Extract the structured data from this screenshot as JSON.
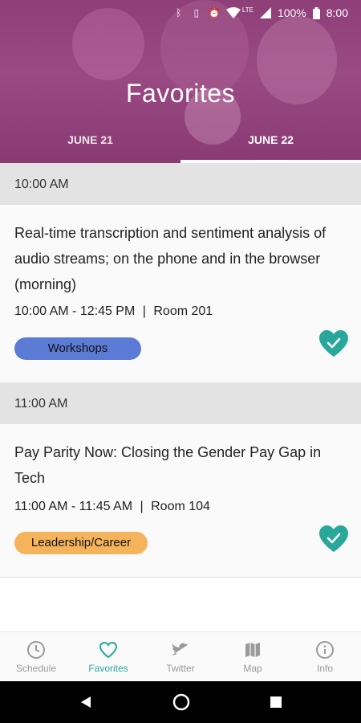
{
  "status_bar": {
    "battery": "100%",
    "time": "8:00",
    "network": "LTE"
  },
  "header": {
    "title": "Favorites",
    "tabs": [
      {
        "label": "JUNE 21",
        "active": false
      },
      {
        "label": "JUNE 22",
        "active": true
      }
    ]
  },
  "sessions": [
    {
      "time_header": "10:00 AM",
      "title": "Real-time transcription and sentiment analysis of audio streams; on the phone and in the browser (morning)",
      "time_range": "10:00 AM - 12:45 PM",
      "separator": "|",
      "room": "Room 201",
      "track": "Workshops",
      "track_color": "#5b7bd5",
      "favorited": true
    },
    {
      "time_header": "11:00 AM",
      "title": "Pay Parity Now: Closing the Gender Pay Gap in Tech",
      "time_range": "11:00 AM - 11:45 AM",
      "separator": "|",
      "room": "Room 104",
      "track": "Leadership/Career",
      "track_color": "#f5b45c",
      "favorited": true
    }
  ],
  "accent_color": "#2aa79b",
  "header_color": "#93437c",
  "bottom_nav": [
    {
      "label": "Schedule",
      "icon": "clock-icon",
      "active": false
    },
    {
      "label": "Favorites",
      "icon": "heart-icon",
      "active": true
    },
    {
      "label": "Twitter",
      "icon": "twitter-icon",
      "active": false
    },
    {
      "label": "Map",
      "icon": "map-icon",
      "active": false
    },
    {
      "label": "Info",
      "icon": "info-icon",
      "active": false
    }
  ]
}
